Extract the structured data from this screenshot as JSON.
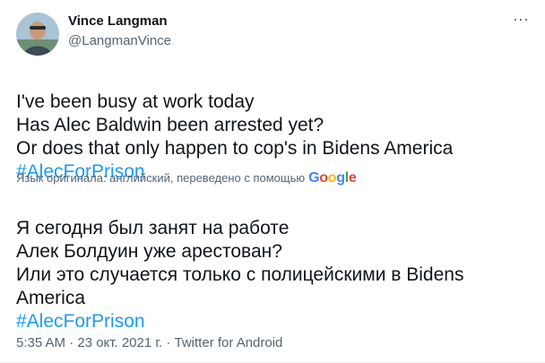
{
  "author": {
    "display_name": "Vince Langman",
    "handle": "@LangmanVince"
  },
  "menu": {
    "more_label": "···"
  },
  "tweet": {
    "text": "I've been busy at work today\nHas Alec Baldwin been arrested yet?\nOr does that only happen to cop's in Bidens America",
    "hashtag": "#AlecForPrison"
  },
  "translation": {
    "note": "Язык оригинала: английский, переведено с помощью",
    "provider_letters": [
      "G",
      "o",
      "o",
      "g",
      "l",
      "e"
    ],
    "text": "Я сегодня был занят на работе\n Алек Болдуин уже арестован?\n Или это случается только с полицейскими в Bidens America",
    "hashtag": "#AlecForPrison"
  },
  "meta": {
    "time_date": "5:35 AM · 23 окт. 2021 г. · ",
    "source": "Twitter for Android"
  },
  "colors": {
    "link": "#1d9bf0",
    "secondary_text": "#536471",
    "primary_text": "#0f1419"
  }
}
